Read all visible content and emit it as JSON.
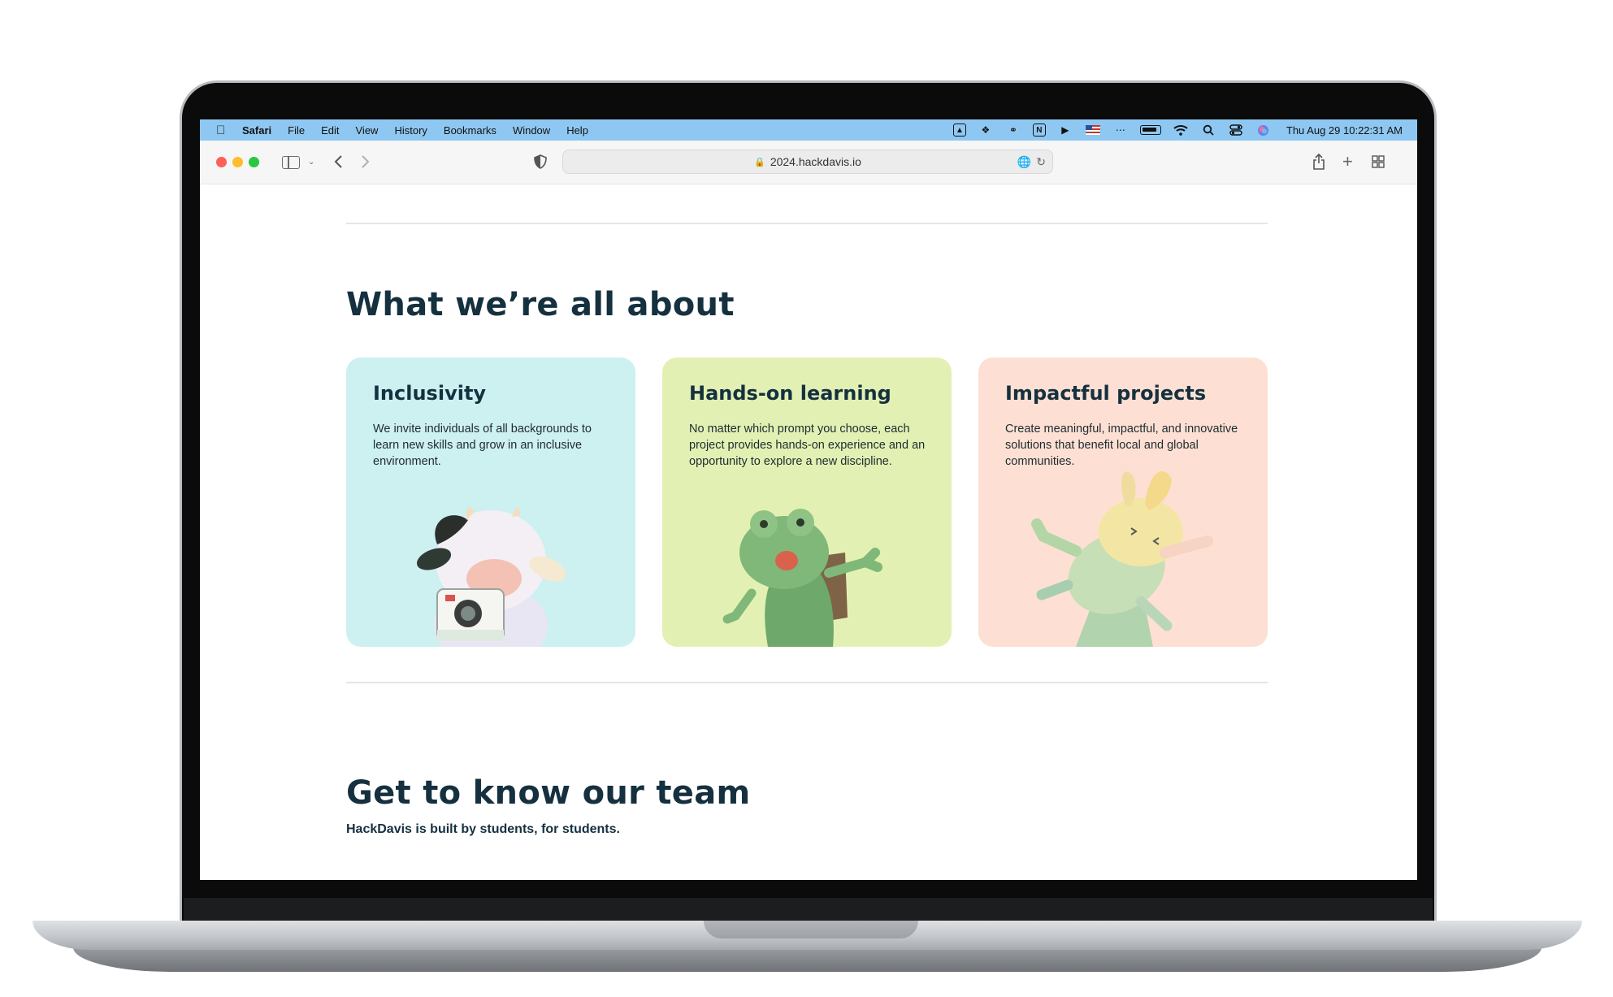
{
  "menubar": {
    "app": "Safari",
    "items": [
      "File",
      "Edit",
      "View",
      "History",
      "Bookmarks",
      "Window",
      "Help"
    ],
    "clock": "Thu Aug 29  10:22:31 AM",
    "tray_icons": [
      "drive-icon",
      "figma-icon",
      "creative-cloud-icon",
      "notion-icon",
      "media-icon",
      "flag-us-icon",
      "activity-icon",
      "battery-icon",
      "wifi-icon",
      "spotlight-icon",
      "control-center-icon",
      "siri-icon"
    ]
  },
  "browser": {
    "url": "2024.hackdavis.io"
  },
  "about": {
    "title": "What we’re all about",
    "cards": [
      {
        "title": "Inclusivity",
        "body": "We invite individuals of all backgrounds to learn new skills and grow in an inclusive environment.",
        "color": "#cdf0f1",
        "illustration": "cow-with-camera"
      },
      {
        "title": "Hands-on learning",
        "body": "No matter which prompt you choose, each project provides hands-on experience and an opportunity to explore a new discipline.",
        "color": "#e2f1b3",
        "illustration": "frog-with-backpack"
      },
      {
        "title": "Impactful projects",
        "body": "Create meaningful, impactful, and innovative solutions that benefit local and global communities.",
        "color": "#fde0d3",
        "illustration": "bunny-jumping"
      }
    ]
  },
  "team": {
    "title": "Get to know our team",
    "subtitle": "HackDavis is built by students, for students."
  }
}
